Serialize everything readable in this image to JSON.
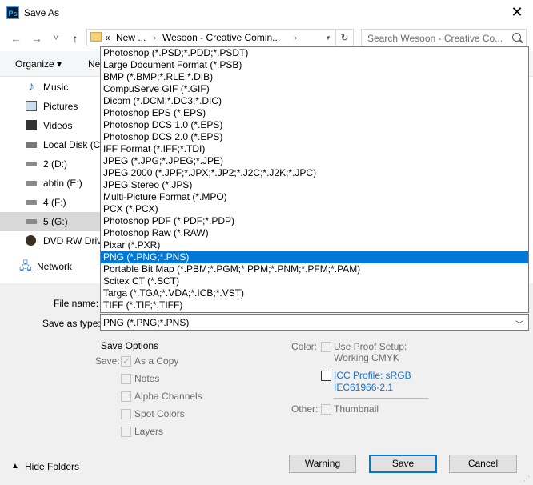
{
  "window": {
    "title": "Save As",
    "app_icon": "Ps",
    "close_label": "✕"
  },
  "nav": {
    "back_icon": "←",
    "forward_icon": "→",
    "dropdown_icon": "˅",
    "up_icon": "↑",
    "address_overflow": "«",
    "breadcrumbs": [
      "New ...",
      "Wesoon - Creative Comin..."
    ],
    "crumb_sep": "›",
    "search_placeholder": "Search Wesoon - Creative Co..."
  },
  "cmdbar": {
    "organize": "Organize ▾",
    "new_folder": "Ne"
  },
  "sidebar": {
    "items": [
      {
        "label": "Music",
        "icon": "music-icon"
      },
      {
        "label": "Pictures",
        "icon": "pictures-icon"
      },
      {
        "label": "Videos",
        "icon": "videos-icon"
      },
      {
        "label": "Local Disk (C:)",
        "icon": "local-disk-icon"
      },
      {
        "label": "2 (D:)",
        "icon": "drive-icon"
      },
      {
        "label": "abtin (E:)",
        "icon": "drive-icon"
      },
      {
        "label": "4 (F:)",
        "icon": "drive-icon"
      },
      {
        "label": "5 (G:)",
        "icon": "drive-icon",
        "selected": true
      },
      {
        "label": "DVD RW Drive",
        "icon": "dvd-icon"
      },
      {
        "label": "Network",
        "icon": "network-icon"
      }
    ]
  },
  "formats": [
    "Photoshop (*.PSD;*.PDD;*.PSDT)",
    "Large Document Format (*.PSB)",
    "BMP (*.BMP;*.RLE;*.DIB)",
    "CompuServe GIF (*.GIF)",
    "Dicom (*.DCM;*.DC3;*.DIC)",
    "Photoshop EPS (*.EPS)",
    "Photoshop DCS 1.0 (*.EPS)",
    "Photoshop DCS 2.0 (*.EPS)",
    "IFF Format (*.IFF;*.TDI)",
    "JPEG (*.JPG;*.JPEG;*.JPE)",
    "JPEG 2000 (*.JPF;*.JPX;*.JP2;*.J2C;*.J2K;*.JPC)",
    "JPEG Stereo (*.JPS)",
    "Multi-Picture Format (*.MPO)",
    "PCX (*.PCX)",
    "Photoshop PDF (*.PDF;*.PDP)",
    "Photoshop Raw (*.RAW)",
    "Pixar (*.PXR)",
    "PNG (*.PNG;*.PNS)",
    "Portable Bit Map (*.PBM;*.PGM;*.PPM;*.PNM;*.PFM;*.PAM)",
    "Scitex CT (*.SCT)",
    "Targa (*.TGA;*.VDA;*.ICB;*.VST)",
    "TIFF (*.TIF;*.TIFF)"
  ],
  "selected_format_index": 17,
  "form": {
    "file_name_label": "File name:",
    "save_as_type_label": "Save as type:",
    "save_as_type_value": "PNG (*.PNG;*.PNS)"
  },
  "options": {
    "heading": "Save Options",
    "save_label": "Save:",
    "as_a_copy": "As a Copy",
    "notes": "Notes",
    "alpha_channels": "Alpha Channels",
    "spot_colors": "Spot Colors",
    "layers": "Layers",
    "color_label": "Color:",
    "use_proof_setup": "Use Proof Setup:",
    "working_cmyk": "Working CMYK",
    "icc_profile": "ICC Profile:  sRGB",
    "icc_profile_2": "IEC61966-2.1",
    "other_label": "Other:",
    "thumbnail": "Thumbnail"
  },
  "footer": {
    "hide_folders": "Hide Folders",
    "warning": "Warning",
    "save": "Save",
    "cancel": "Cancel"
  }
}
